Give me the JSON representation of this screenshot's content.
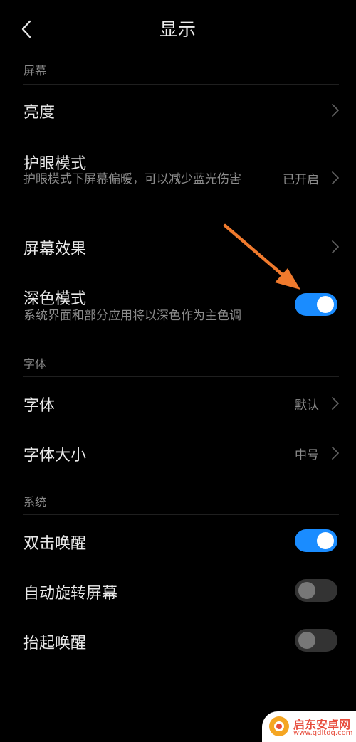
{
  "header": {
    "title": "显示"
  },
  "sections": {
    "screen": {
      "label": "屏幕",
      "brightness": {
        "title": "亮度"
      },
      "eye_care": {
        "title": "护眼模式",
        "subtitle": "护眼模式下屏幕偏暖，可以减少蓝光伤害",
        "value": "已开启"
      },
      "screen_effect": {
        "title": "屏幕效果"
      },
      "dark_mode": {
        "title": "深色模式",
        "subtitle": "系统界面和部分应用将以深色作为主色调",
        "enabled": true
      }
    },
    "font": {
      "label": "字体",
      "font": {
        "title": "字体",
        "value": "默认"
      },
      "font_size": {
        "title": "字体大小",
        "value": "中号"
      }
    },
    "system": {
      "label": "系统",
      "double_tap_wake": {
        "title": "双击唤醒",
        "enabled": true
      },
      "auto_rotate": {
        "title": "自动旋转屏幕",
        "enabled": false
      },
      "raise_to_wake": {
        "title": "抬起唤醒",
        "enabled": false
      }
    }
  },
  "colors": {
    "background": "#000000",
    "toggle_on": "#1a8cff",
    "toggle_off": "#333333",
    "annotation_arrow": "#f07a2d"
  },
  "watermark": {
    "name": "启东安卓网",
    "url": "www.qdltdq.com"
  }
}
